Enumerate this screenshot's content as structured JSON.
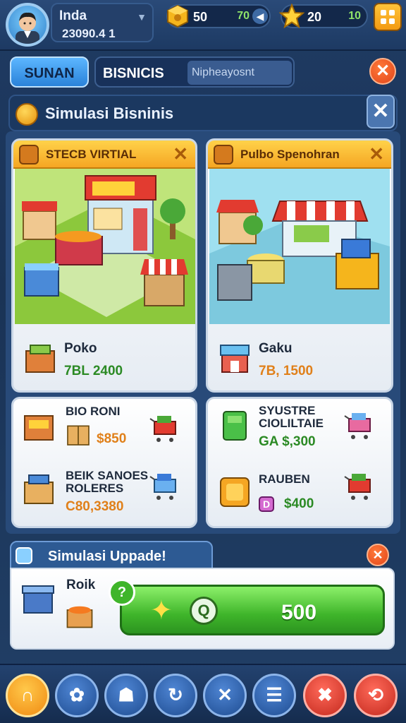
{
  "player": {
    "name": "Inda",
    "money": "23090.4 1"
  },
  "resources": [
    {
      "icon": "gold-cube-icon",
      "value": "50",
      "secondary": "70"
    },
    {
      "icon": "star-icon",
      "value": "20",
      "secondary": "10"
    }
  ],
  "tabs": {
    "active": "SUNAN",
    "second": "BISNICIS",
    "search_placeholder": "Nipheayosnt"
  },
  "panel": {
    "title": "Simulasi Bisninis"
  },
  "cards": {
    "left": {
      "title": "STECB VIRTIAL",
      "item_name": "Poko",
      "item_price": "7BL 2400"
    },
    "right": {
      "title": "Pulbo Spenohran",
      "item_name": "Gaku",
      "item_price": "7B, 1500"
    }
  },
  "lists": {
    "left": [
      {
        "name": "BIO RONI",
        "price": "$850"
      },
      {
        "name": "BEIK SANOES ROLERES",
        "price": "C80,3380"
      }
    ],
    "right": [
      {
        "name": "SYUSTRE CIOLILTAIE",
        "price": "GA $,300"
      },
      {
        "name": "RAUBEN",
        "price": "$400"
      }
    ]
  },
  "upgrade": {
    "title": "Simulasi Uppade!",
    "item_name": "Roik",
    "button_value": "500",
    "badge": "?"
  },
  "colors": {
    "accent_orange": "#f5a623",
    "accent_green": "#3fb52a",
    "bg_navy": "#1f3b63"
  }
}
